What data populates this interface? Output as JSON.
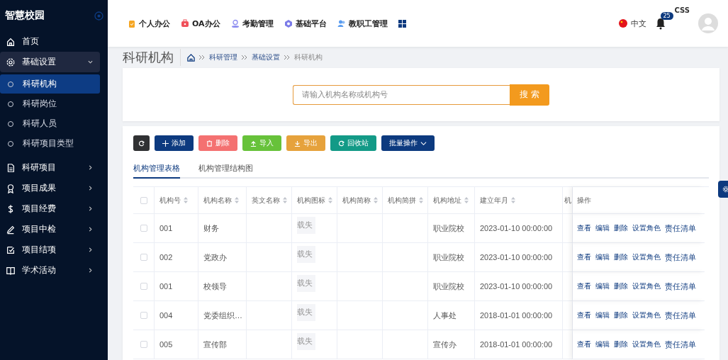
{
  "sidebar": {
    "logo": "智慧校园",
    "items": [
      {
        "label": "首页"
      },
      {
        "label": "基础设置",
        "expanded": true,
        "children": [
          {
            "label": "科研机构",
            "selected": true
          },
          {
            "label": "科研岗位",
            "selected": false
          },
          {
            "label": "科研人员",
            "selected": false
          },
          {
            "label": "科研项目类型",
            "selected": false
          }
        ]
      },
      {
        "label": "科研项目",
        "expanded": false
      },
      {
        "label": "项目成果",
        "expanded": false
      },
      {
        "label": "项目经费",
        "expanded": false
      },
      {
        "label": "项目中检",
        "expanded": false
      },
      {
        "label": "项目结项",
        "expanded": false
      },
      {
        "label": "学术活动",
        "expanded": false
      }
    ]
  },
  "header": {
    "nav": [
      {
        "label": "个人办公",
        "color": "#f5a623"
      },
      {
        "label": "OA办公",
        "color": "#f0505a"
      },
      {
        "label": "考勤管理",
        "color": "#8c8cf0"
      },
      {
        "label": "基础平台",
        "color": "#7b7be8"
      },
      {
        "label": "教职工管理",
        "color": "#5a9cf0"
      }
    ],
    "language": "中文",
    "notifications": "25",
    "user": "CSS"
  },
  "page_title": "科研机构",
  "breadcrumb": [
    {
      "label": "科研管理",
      "current": false
    },
    {
      "label": "基础设置",
      "current": false
    },
    {
      "label": "科研机构",
      "current": true
    }
  ],
  "search": {
    "placeholder": "请输入机构名称或机构号",
    "button": "搜 索"
  },
  "toolbar": [
    {
      "color": "#303133"
    },
    {
      "label": "添加",
      "color": "#0d3a7f"
    },
    {
      "label": "删除",
      "color": "#f47171"
    },
    {
      "label": "导入",
      "color": "#67c23a"
    },
    {
      "label": "导出",
      "color": "#e6a23c"
    },
    {
      "label": "回收站",
      "color": "#139a87"
    },
    {
      "label": "批量操作",
      "color": "#0d3a7f"
    }
  ],
  "tabs": [
    {
      "label": "机构管理表格",
      "selected": true
    },
    {
      "label": "机构管理结构图",
      "selected": false
    }
  ],
  "table": {
    "all_checked": false,
    "columns": [
      {
        "label": "机构号",
        "sortable": true
      },
      {
        "label": "机构名称",
        "sortable": true
      },
      {
        "label": "英文名称",
        "sortable": true
      },
      {
        "label": "机构图标",
        "sortable": true
      },
      {
        "label": "机构简称",
        "sortable": true
      },
      {
        "label": "机构简拼",
        "sortable": true
      },
      {
        "label": "机构地址",
        "sortable": true
      },
      {
        "label": "建立年月",
        "sortable": true
      },
      {
        "label": "机"
      },
      {
        "label": "操作",
        "sortable": false
      }
    ],
    "rows": [
      {
        "checked": false,
        "code": "001",
        "name": "财务",
        "icon_alt": "载失",
        "address": "职业院校",
        "founded": "2023-01-10 00:00:00",
        "actions": [
          "查看",
          "编辑",
          "删除",
          "设置角色",
          "责任清单"
        ]
      },
      {
        "checked": false,
        "code": "002",
        "name": "党政办",
        "icon_alt": "载失",
        "address": "职业院校",
        "founded": "2023-01-10 00:00:00",
        "actions": [
          "查看",
          "编辑",
          "删除",
          "设置角色",
          "责任清单"
        ]
      },
      {
        "checked": false,
        "code": "001",
        "name": "校领导",
        "icon_alt": "载失",
        "address": "职业院校",
        "founded": "2023-01-10 00:00:00",
        "actions": [
          "查看",
          "编辑",
          "删除",
          "设置角色",
          "责任清单"
        ]
      },
      {
        "checked": false,
        "code": "004",
        "name": "党委组织…",
        "icon_alt": "载失",
        "address": "人事处",
        "founded": "2018-01-01 00:00:00",
        "actions": [
          "查看",
          "编辑",
          "删除",
          "设置角色",
          "责任清单"
        ]
      },
      {
        "checked": false,
        "code": "005",
        "name": "宣传部",
        "icon_alt": "载失",
        "address": "宣传办",
        "founded": "2018-01-01 00:00:00",
        "actions": [
          "查看",
          "编辑",
          "删除",
          "设置角色",
          "责任清单"
        ]
      }
    ]
  }
}
